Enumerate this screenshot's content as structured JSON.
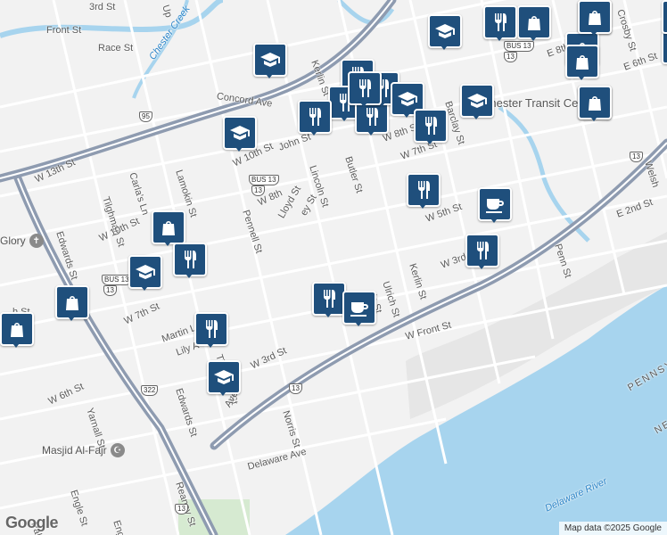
{
  "streets": [
    "3rd St",
    "Front St",
    "Race St",
    "Concord Ave",
    "Kerlin St",
    "John St",
    "W 10th St",
    "Lamokin St",
    "Carla's Ln",
    "W 13th St",
    "Tilghman St",
    "Edwards St",
    "W 10th St",
    "Glory",
    "W 7th St",
    "Martin L",
    "Lily A",
    "W 8th",
    "Lloyd St",
    "Pennell St",
    "ey St",
    "Lincoln St",
    "Butler St",
    "W 8th St",
    "W 7th St",
    "W 5th St",
    "E 2nd St",
    "Penn St",
    "Kerlin St",
    "Ulrich St",
    "W 3rd",
    "'s St",
    "W Front St",
    "W 3rd St",
    "Tilghman St",
    "Edwards St",
    "Ave",
    "Norris St",
    "W 6th St",
    "Yarnall St",
    "Delaware Ave",
    "Engle St",
    "Reaney St",
    "Engle",
    "Palm",
    "E 8th",
    "E 6th St",
    "Crosby St",
    "Barclay St",
    "Welsh",
    "Chester Transit Ce",
    "h St",
    "Up"
  ],
  "water_labels": [
    "Chester Creek",
    "Delaware River",
    "PENNSYL",
    "NEW"
  ],
  "shields": [
    "BUS 13",
    "13",
    "BUS 13",
    "13",
    "95",
    "13",
    "13",
    "13",
    "322",
    "BUS 13",
    "13",
    "13"
  ],
  "pois": [
    {
      "name": "Glory",
      "icon": "church-icon"
    },
    {
      "name": "Masjid Al-Fajr",
      "icon": "mosque-icon"
    }
  ],
  "pins": [
    "school",
    "shopping",
    "shopping",
    "shopping",
    "school",
    "restaurant",
    "restaurant",
    "restaurant",
    "restaurant",
    "restaurant",
    "restaurant",
    "school",
    "school",
    "restaurant",
    "school",
    "shopping",
    "restaurant",
    "school",
    "restaurant",
    "shopping",
    "restaurant",
    "shopping",
    "restaurant",
    "cafe",
    "restaurant",
    "restaurant",
    "cafe",
    "school",
    "shopping",
    "shopping",
    "shopping",
    "shopping",
    "shopping",
    "cart"
  ],
  "attribution": "Map data ©2025 Google",
  "logo": "Google",
  "colors": {
    "pin": "#1f4f7c",
    "water": "#a7d4ee",
    "road": "#ffffff",
    "highway": "#8e9bb0",
    "land": "#f2f2f2"
  }
}
